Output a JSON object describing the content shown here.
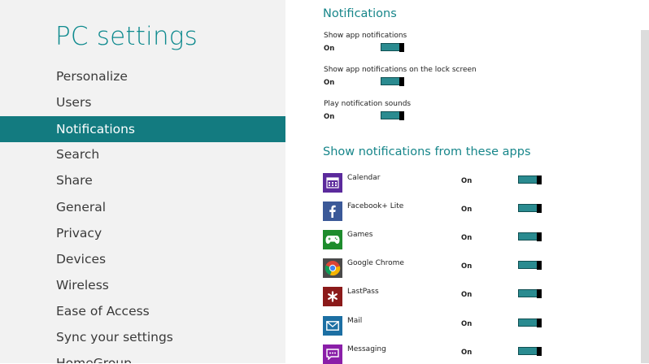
{
  "sidebar": {
    "title": "PC settings",
    "items": [
      {
        "label": "Personalize"
      },
      {
        "label": "Users"
      },
      {
        "label": "Notifications"
      },
      {
        "label": "Search"
      },
      {
        "label": "Share"
      },
      {
        "label": "General"
      },
      {
        "label": "Privacy"
      },
      {
        "label": "Devices"
      },
      {
        "label": "Wireless"
      },
      {
        "label": "Ease of Access"
      },
      {
        "label": "Sync your settings"
      },
      {
        "label": "HomeGroup"
      }
    ],
    "selected": "Notifications"
  },
  "notifications": {
    "heading": "Notifications",
    "settings": [
      {
        "label": "Show app notifications",
        "value": "On"
      },
      {
        "label": "Show app notifications on the lock screen",
        "value": "On"
      },
      {
        "label": "Play notification sounds",
        "value": "On"
      }
    ]
  },
  "apps_section": {
    "heading": "Show notifications from these apps",
    "apps": [
      {
        "name": "Calendar",
        "value": "On",
        "icon": "calendar-icon",
        "color": "#5b2a9c"
      },
      {
        "name": "Facebook+ Lite",
        "value": "On",
        "icon": "facebook-icon",
        "color": "#3b5998"
      },
      {
        "name": "Games",
        "value": "On",
        "icon": "gamepad-icon",
        "color": "#1e8c2d"
      },
      {
        "name": "Google Chrome",
        "value": "On",
        "icon": "chrome-icon",
        "color": "#4a4a4a"
      },
      {
        "name": "LastPass",
        "value": "On",
        "icon": "lastpass-icon",
        "color": "#8b1a1a"
      },
      {
        "name": "Mail",
        "value": "On",
        "icon": "mail-icon",
        "color": "#1c6fa3"
      },
      {
        "name": "Messaging",
        "value": "On",
        "icon": "messaging-icon",
        "color": "#8a1fa8"
      }
    ]
  },
  "colors": {
    "accent": "#17868a",
    "selected_bg": "#137b80",
    "toggle_on": "#2a8b90"
  }
}
